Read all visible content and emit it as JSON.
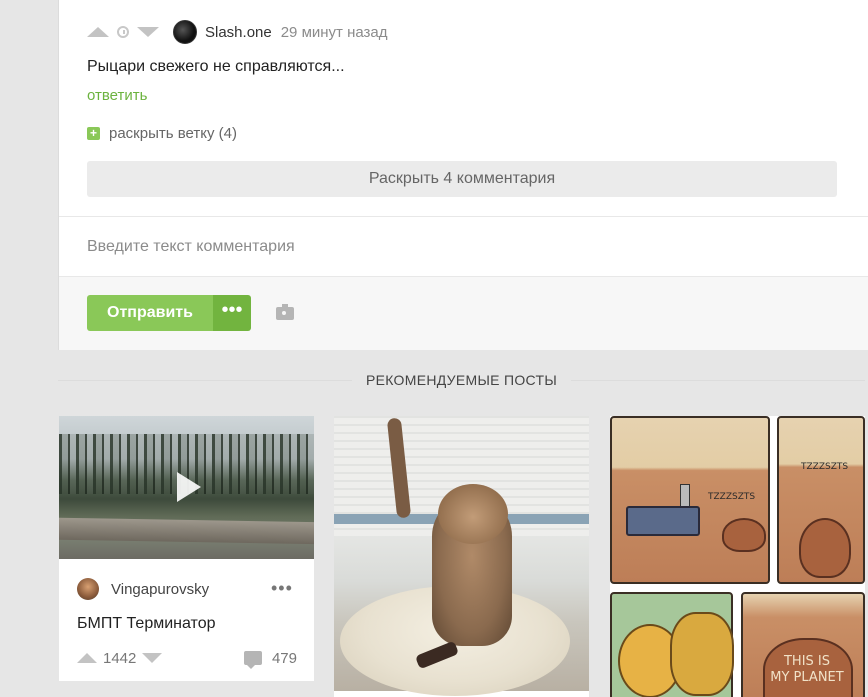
{
  "comment": {
    "author": "Slash.one",
    "time": "29 минут назад",
    "text": "Рыцари свежего не справляются...",
    "reply_label": "ответить",
    "expand_branch_label": "раскрыть ветку (4)",
    "expand_comments_label": "Раскрыть 4 комментария"
  },
  "composer": {
    "placeholder": "Введите текст комментария",
    "send_label": "Отправить",
    "more_label": "•••"
  },
  "recommended": {
    "title": "РЕКОМЕНДУЕМЫЕ ПОСТЫ",
    "posts": [
      {
        "author": "Vingapurovsky",
        "more_label": "•••",
        "title": "БМПТ Терминатор",
        "rating": "1442",
        "comments": "479",
        "media": "video"
      },
      {
        "media": "image"
      },
      {
        "media": "comic",
        "comic_text": [
          "TZZZSZTS",
          "TZZZSZTS",
          "THIS IS",
          "MY PLANET"
        ]
      }
    ]
  },
  "colors": {
    "accent_green": "#8ac858",
    "accent_green_dark": "#72b43f",
    "link_green": "#6cb33f",
    "background": "#e6e6e6"
  },
  "icons": [
    "upvote-icon",
    "clock-icon",
    "downvote-icon",
    "plus-icon",
    "camera-icon",
    "play-icon",
    "comment-icon",
    "more-icon"
  ]
}
